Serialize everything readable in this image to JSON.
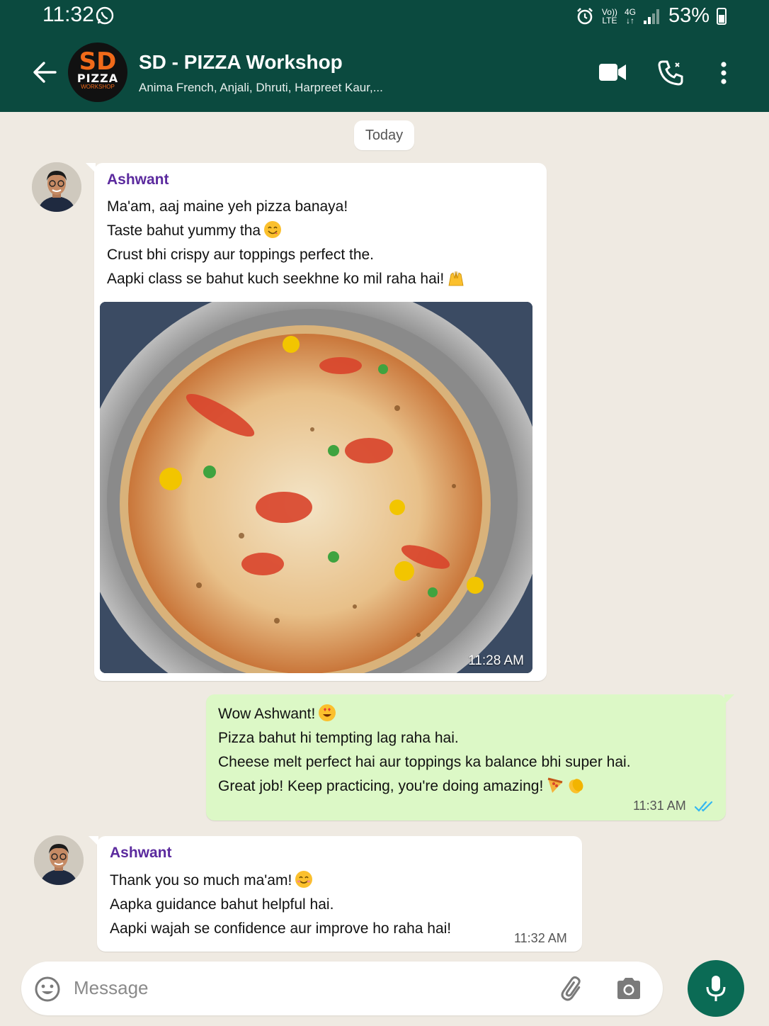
{
  "status_bar": {
    "time": "11:32",
    "volte": "Vo))",
    "lte": "LTE",
    "network": "4G",
    "battery": "53%"
  },
  "header": {
    "title": "SD - PIZZA Workshop",
    "subtitle": "Anima French, Anjali, Dhruti, Harpreet Kaur,...",
    "avatar_line1": "SD",
    "avatar_line2": "PIZZA",
    "avatar_line3": "WORKSHOP",
    "icons": [
      "back-arrow-icon",
      "video-call-icon",
      "voice-call-icon",
      "more-options-icon"
    ]
  },
  "date_chip": "Today",
  "messages": [
    {
      "sender": "Ashwant",
      "lines": [
        "Ma'am, aaj maine yeh pizza banaya!",
        "Taste bahut yummy tha",
        "Crust bhi crispy aur toppings perfect the.",
        "Aapki class se bahut kuch seekhne ko mil raha hai!"
      ],
      "time": "11:28 AM"
    },
    {
      "lines": [
        "Wow Ashwant!",
        "Pizza bahut hi tempting lag raha hai.",
        "Cheese melt perfect hai aur toppings ka balance bhi super hai.",
        "Great job! Keep practicing, you're doing amazing!"
      ],
      "time": "11:31 AM"
    },
    {
      "sender": "Ashwant",
      "lines": [
        "Thank you so much ma'am!",
        "Aapka guidance bahut helpful hai.",
        "Aapki wajah se confidence aur improve ho raha hai!"
      ],
      "time": "11:32 AM"
    }
  ],
  "composer": {
    "placeholder": "Message",
    "icons": [
      "emoji-icon",
      "attach-icon",
      "camera-icon",
      "mic-icon"
    ]
  },
  "colors": {
    "header_bg": "#0b4a3f",
    "chat_bg": "#efeae2",
    "outgoing_bubble": "#dcf8c6",
    "sender_name": "#5b2a9e",
    "read_ticks": "#34b7f1",
    "mic_button": "#0b6b55"
  }
}
